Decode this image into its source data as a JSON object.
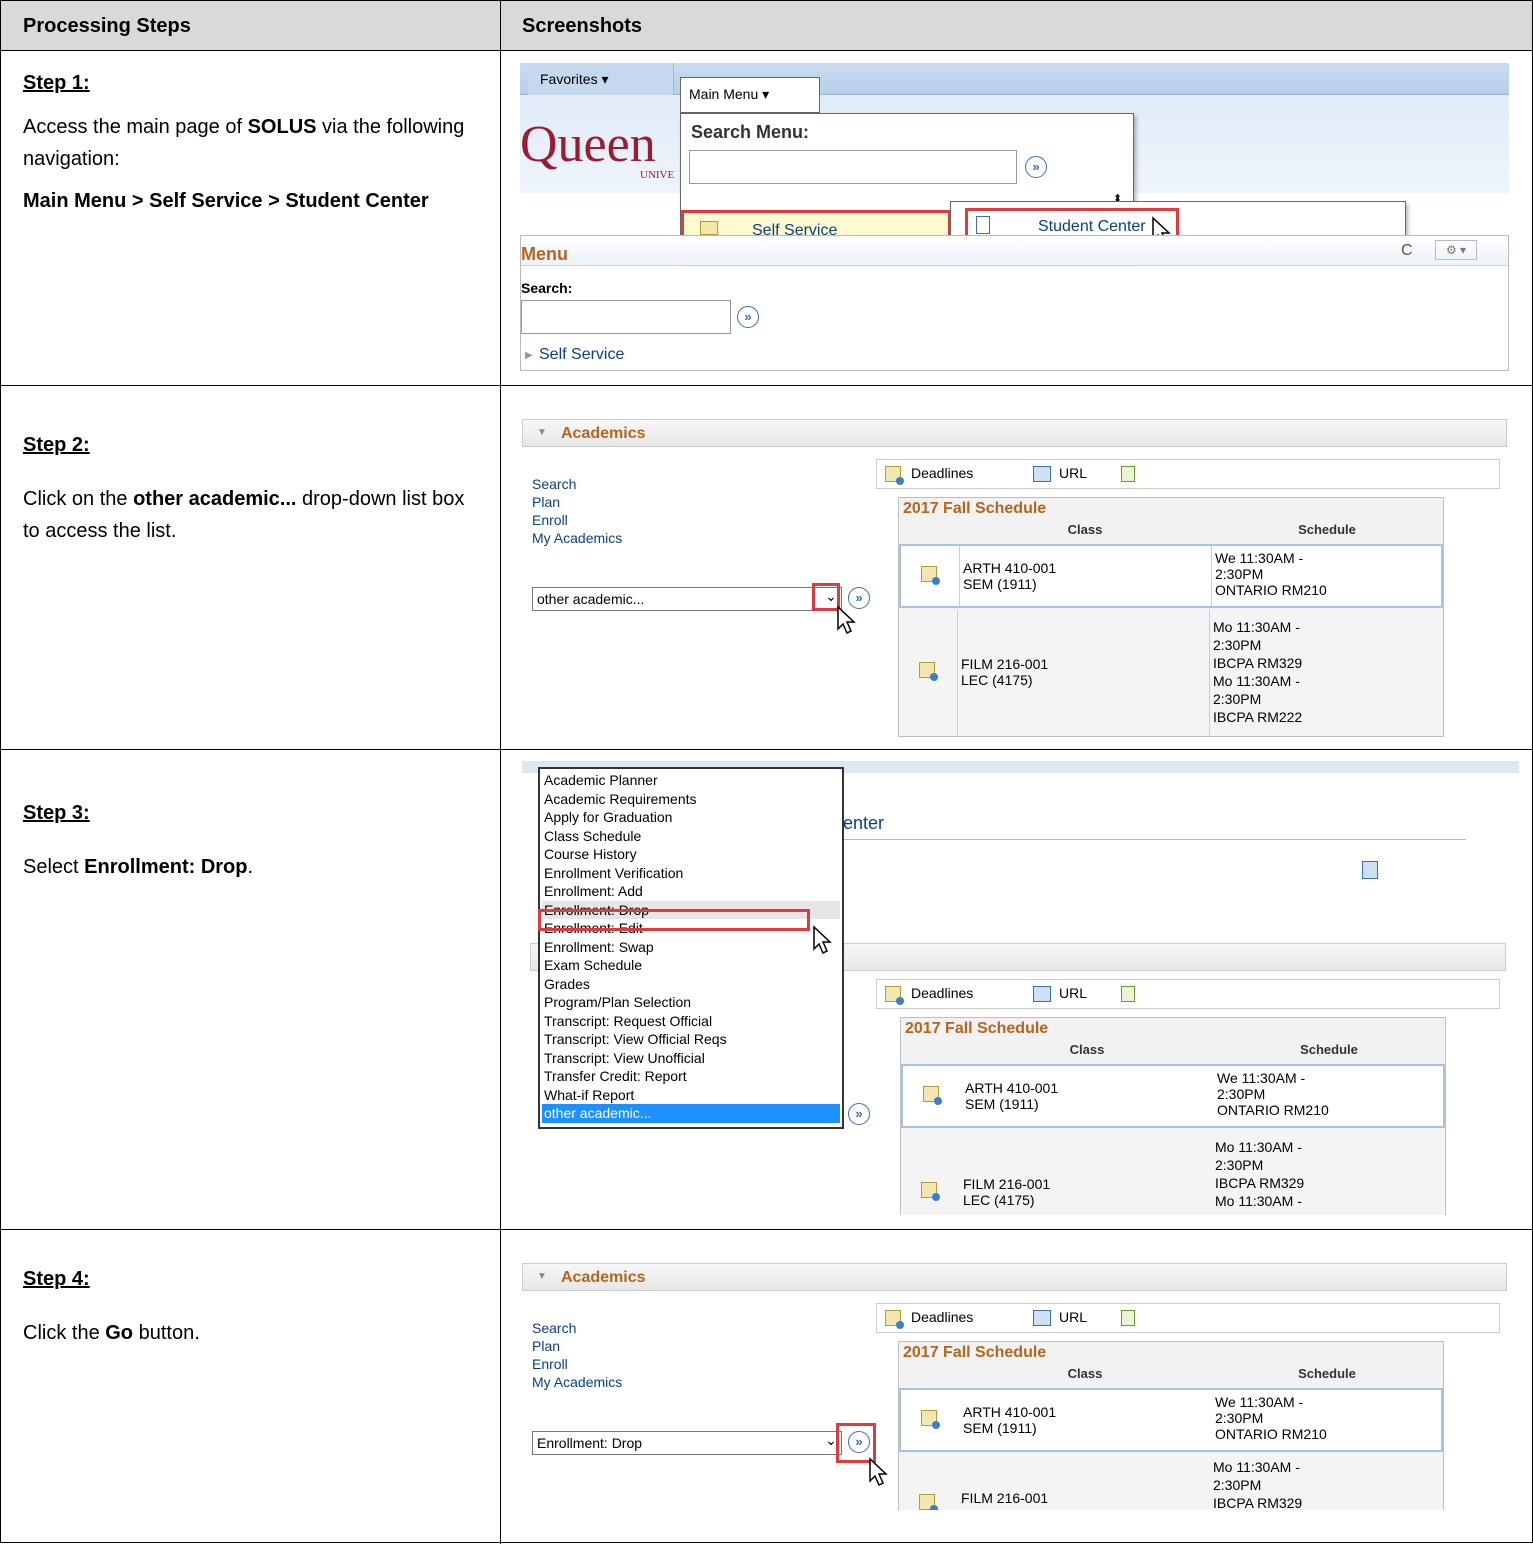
{
  "header": {
    "col1": "Processing Steps",
    "col2": "Screenshots"
  },
  "steps": [
    {
      "title": "Step 1:",
      "body_html_parts": [
        "Access the main page of ",
        "SOLUS",
        " via the following navigation:"
      ],
      "body2": "Main Menu > Self Service > Student Center"
    },
    {
      "title": "Step 2:",
      "body_parts": [
        "Click on the ",
        "other academic...",
        " drop-down list box to access the list."
      ]
    },
    {
      "title": "Step 3:",
      "body_parts": [
        "Select ",
        "Enrollment: Drop",
        "."
      ]
    },
    {
      "title": "Step 4:",
      "body_parts": [
        "Click the ",
        "Go",
        " button."
      ]
    }
  ],
  "shot1": {
    "favorites": "Favorites ▾",
    "main_menu": "Main Menu ▾",
    "logo": "Queen",
    "logo_sub": "UNIVE",
    "search_menu_label": "Search Menu:",
    "self_service": "Self Service",
    "student_center": "Student Center",
    "menu_title": "Menu",
    "search_label": "Search:",
    "self_service_link": "Self Service",
    "gear": "⚙ ▾"
  },
  "academics": {
    "title": "Academics",
    "links": [
      "Search",
      "Plan",
      "Enroll",
      "My Academics"
    ],
    "deadlines": "Deadlines",
    "url": "URL",
    "schedule_title": "2017 Fall Schedule",
    "col_class": "Class",
    "col_schedule": "Schedule",
    "rows": [
      {
        "class": [
          "ARTH 410-001",
          "SEM (1911)"
        ],
        "schedule": [
          "We 11:30AM -",
          "2:30PM",
          "ONTARIO RM210"
        ]
      },
      {
        "class": [
          "FILM 216-001",
          "LEC (4175)"
        ],
        "schedule": [
          "Mo 11:30AM -",
          "2:30PM",
          "IBCPA RM329",
          "Mo 11:30AM -",
          "2:30PM",
          "IBCPA RM222"
        ]
      }
    ]
  },
  "shot2": {
    "dropdown_value": "other academic..."
  },
  "shot3": {
    "center_text": "Center",
    "list_items": [
      "Academic Planner",
      "Academic Requirements",
      "Apply for Graduation",
      "Class Schedule",
      "Course History",
      "Enrollment Verification",
      "Enrollment: Add",
      "Enrollment: Drop",
      "Enrollment: Edit",
      "Enrollment: Swap",
      "Exam Schedule",
      "Grades",
      "Program/Plan Selection",
      "Transcript: Request Official",
      "Transcript: View Official Reqs",
      "Transcript: View Unofficial",
      "Transfer Credit: Report",
      "What-if Report",
      "other academic..."
    ],
    "selected_index": 18,
    "hover_index": 7
  },
  "shot4": {
    "dropdown_value": "Enrollment: Drop"
  },
  "colors": {
    "header_bg": "#d9d9d9",
    "link": "#0b3e8a",
    "academics_title": "#b5651d",
    "highlight": "#e0393e",
    "select_blue": "#1e90ff"
  }
}
